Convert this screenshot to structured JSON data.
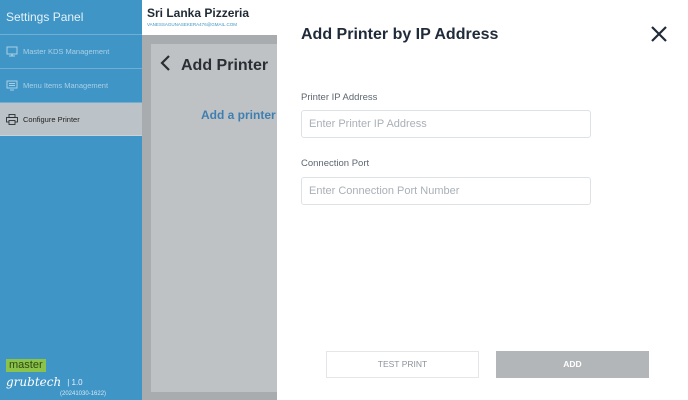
{
  "sidebar": {
    "title": "Settings Panel",
    "items": [
      {
        "label": "Master KDS Management",
        "icon": "monitor-icon"
      },
      {
        "label": "Menu Items Management",
        "icon": "menu-icon"
      },
      {
        "label": "Configure Printer",
        "icon": "printer-icon",
        "active": true
      }
    ],
    "footer": {
      "logo_top": "master",
      "logo_bottom": "grubtech",
      "version": "| 1.0",
      "build": "(20241030-1622)"
    }
  },
  "store": {
    "name": "Sri Lanka Pizzeria",
    "email": "VANESSAGUNASEKERA476@GMAIL.COM"
  },
  "page": {
    "back_title": "Add Printer",
    "add_link": "Add a printer b"
  },
  "modal": {
    "title": "Add Printer by IP Address",
    "ip_label": "Printer IP Address",
    "ip_placeholder": "Enter Printer IP Address",
    "ip_value": "",
    "port_label": "Connection Port",
    "port_placeholder": "Enter Connection Port Number",
    "port_value": "",
    "test_button": "TEST PRINT",
    "add_button": "ADD"
  },
  "colors": {
    "sidebar": "#3f95c6",
    "active_item": "#bcc3c8",
    "overlay": "#a9acaf",
    "disabled_button": "#b3b6b9"
  }
}
